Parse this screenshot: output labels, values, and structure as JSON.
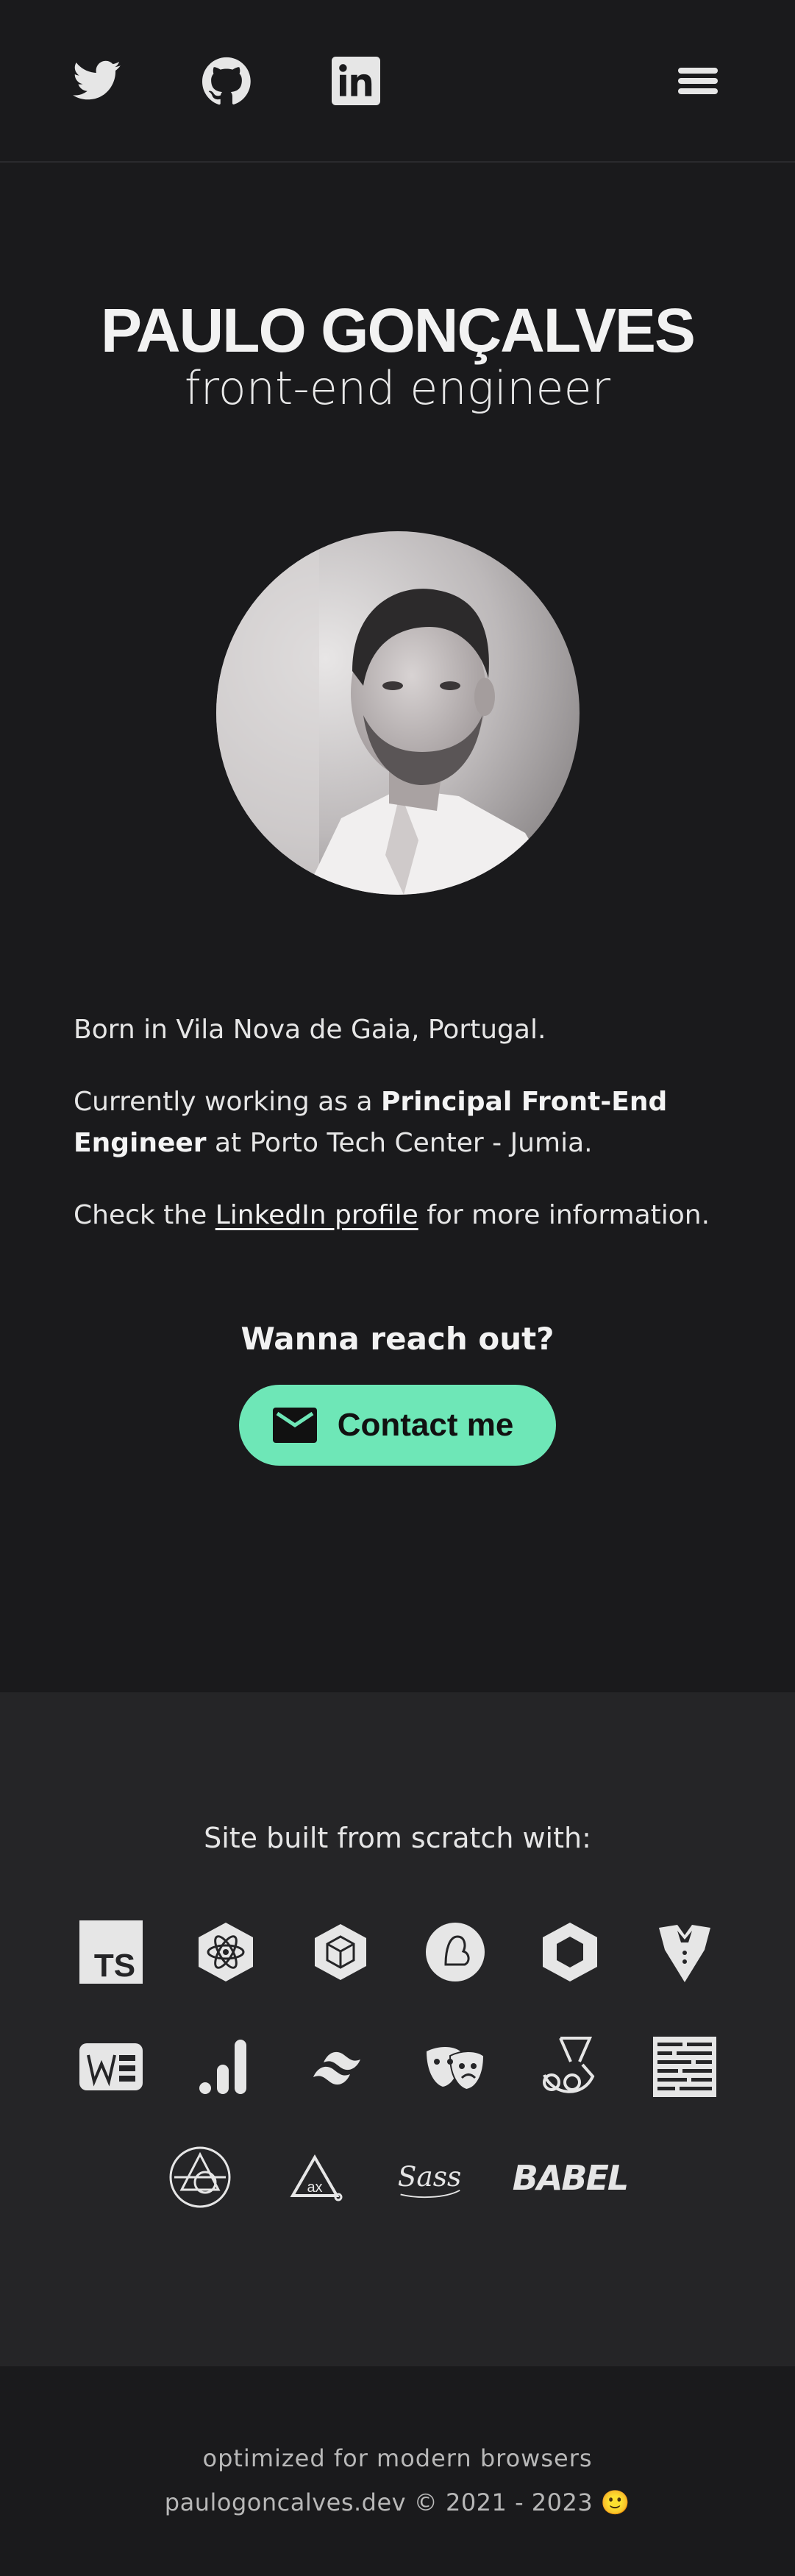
{
  "header": {
    "social": [
      {
        "icon": "twitter-icon"
      },
      {
        "icon": "github-icon"
      },
      {
        "icon": "linkedin-icon"
      }
    ],
    "menu_icon": "hamburger-menu-icon"
  },
  "hero": {
    "name": "PAULO GONÇALVES",
    "role": "front-end engineer"
  },
  "bio": {
    "line1": "Born in Vila Nova de Gaia, Portugal.",
    "line2_pre": "Currently working as a ",
    "line2_bold": "Principal Front-End Engineer",
    "line2_post": " at Porto Tech Center - Jumia.",
    "line3_pre": "Check the ",
    "line3_link": "LinkedIn profile",
    "line3_post": " for more information."
  },
  "reach": {
    "title": "Wanna reach out?",
    "button_label": "Contact me"
  },
  "built": {
    "label": "Site built from scratch with:",
    "technologies": [
      "typescript",
      "react",
      "webpack",
      "parcel",
      "codesandbox",
      "jest",
      "webflow",
      "lighthouse",
      "tailwind",
      "storybook",
      "jest-jester",
      "nx",
      "prisma",
      "ax",
      "sass",
      "babel"
    ]
  },
  "footer": {
    "line1": "optimized for modern browsers",
    "line2": "paulogoncalves.dev © 2021 - 2023 🙂"
  },
  "colors": {
    "background": "#1a1a1c",
    "section_alt": "#252527",
    "accent": "#6ee7b7"
  }
}
